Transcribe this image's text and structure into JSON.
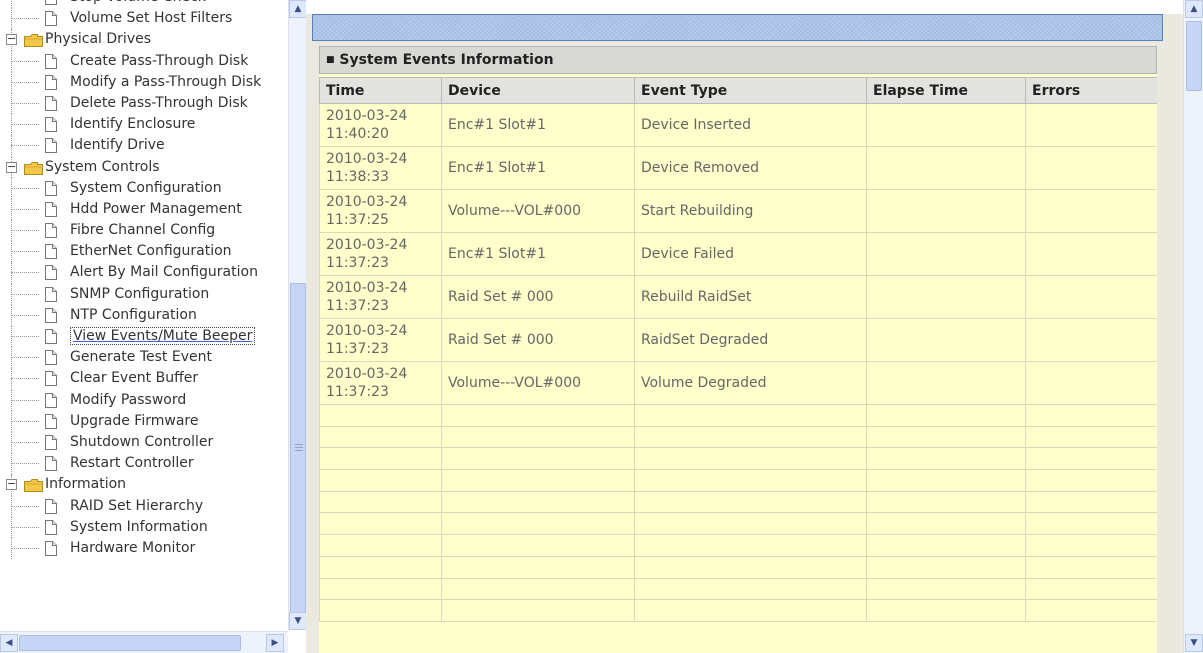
{
  "tree": {
    "nodes": [
      {
        "label": "Stop Volume Check",
        "level": 1
      },
      {
        "label": "Volume Set Host Filters",
        "level": 1
      },
      {
        "label": "Physical Drives",
        "level": 0
      },
      {
        "label": "Create Pass-Through Disk",
        "level": 1
      },
      {
        "label": "Modify a Pass-Through Disk",
        "level": 1
      },
      {
        "label": "Delete Pass-Through Disk",
        "level": 1
      },
      {
        "label": "Identify Enclosure",
        "level": 1
      },
      {
        "label": "Identify Drive",
        "level": 1
      },
      {
        "label": "System Controls",
        "level": 0
      },
      {
        "label": "System Configuration",
        "level": 1
      },
      {
        "label": "Hdd Power Management",
        "level": 1
      },
      {
        "label": "Fibre Channel Config",
        "level": 1
      },
      {
        "label": "EtherNet Configuration",
        "level": 1
      },
      {
        "label": "Alert By Mail Configuration",
        "level": 1
      },
      {
        "label": "SNMP Configuration",
        "level": 1
      },
      {
        "label": "NTP Configuration",
        "level": 1
      },
      {
        "label": "View Events/Mute Beeper",
        "level": 1,
        "selected": true
      },
      {
        "label": "Generate Test Event",
        "level": 1
      },
      {
        "label": "Clear Event Buffer",
        "level": 1
      },
      {
        "label": "Modify Password",
        "level": 1
      },
      {
        "label": "Upgrade Firmware",
        "level": 1
      },
      {
        "label": "Shutdown Controller",
        "level": 1
      },
      {
        "label": "Restart Controller",
        "level": 1
      },
      {
        "label": "Information",
        "level": 0
      },
      {
        "label": "RAID Set Hierarchy",
        "level": 1
      },
      {
        "label": "System Information",
        "level": 1
      },
      {
        "label": "Hardware Monitor",
        "level": 1
      }
    ]
  },
  "panel": {
    "title": "System Events Information",
    "columns": [
      "Time",
      "Device",
      "Event Type",
      "Elapse Time",
      "Errors"
    ],
    "rows": [
      {
        "date": "2010-03-24",
        "time": "11:40:20",
        "device": "Enc#1 Slot#1",
        "event_type": "Device Inserted",
        "elapse_time": "",
        "errors": ""
      },
      {
        "date": "2010-03-24",
        "time": "11:38:33",
        "device": "Enc#1 Slot#1",
        "event_type": "Device Removed",
        "elapse_time": "",
        "errors": ""
      },
      {
        "date": "2010-03-24",
        "time": "11:37:25",
        "device": "Volume---VOL#000",
        "event_type": "Start Rebuilding",
        "elapse_time": "",
        "errors": ""
      },
      {
        "date": "2010-03-24",
        "time": "11:37:23",
        "device": "Enc#1 Slot#1",
        "event_type": "Device Failed",
        "elapse_time": "",
        "errors": ""
      },
      {
        "date": "2010-03-24",
        "time": "11:37:23",
        "device": "Raid Set # 000",
        "event_type": "Rebuild RaidSet",
        "elapse_time": "",
        "errors": ""
      },
      {
        "date": "2010-03-24",
        "time": "11:37:23",
        "device": "Raid Set # 000",
        "event_type": "RaidSet Degraded",
        "elapse_time": "",
        "errors": ""
      },
      {
        "date": "2010-03-24",
        "time": "11:37:23",
        "device": "Volume---VOL#000",
        "event_type": "Volume Degraded",
        "elapse_time": "",
        "errors": ""
      }
    ]
  },
  "colors": {
    "panel_background": "#ffffcc",
    "header_background": "#d8d8d4",
    "top_bar": "#b6ccea",
    "folder": "#f2c84b"
  },
  "icons": {
    "folder": "folder-icon",
    "page": "page-icon",
    "expander": "collapse-icon"
  }
}
